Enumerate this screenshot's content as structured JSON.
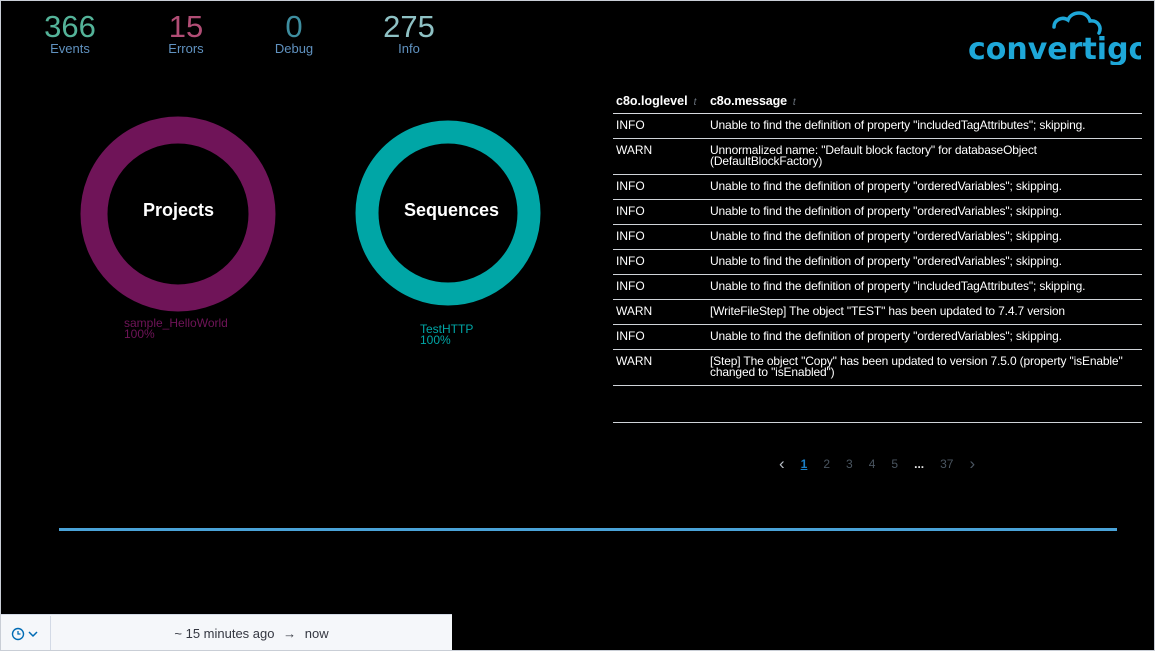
{
  "metrics": [
    {
      "value": "366",
      "label": "Events",
      "num_color": "#54b399",
      "label_color": "#6092c0"
    },
    {
      "value": "15",
      "label": "Errors",
      "num_color": "#b14d75",
      "label_color": "#6092c0"
    },
    {
      "value": "0",
      "label": "Debug",
      "num_color": "#3e8ea0",
      "label_color": "#6092c0"
    },
    {
      "value": "275",
      "label": "Info",
      "num_color": "#8ec1c4",
      "label_color": "#6092c0"
    }
  ],
  "brand": {
    "logo_text": "convertigo",
    "color": "#1ea7d8"
  },
  "donuts": {
    "projects": {
      "title": "Projects",
      "legend_name": "sample_HelloWorld",
      "legend_pct": "100%",
      "color": "#6f1458"
    },
    "sequences": {
      "title": "Sequences",
      "legend_name": "TestHTTP",
      "legend_pct": "100%",
      "color": "#00a6a6"
    }
  },
  "table": {
    "headers": {
      "level": "c8o.loglevel",
      "message": "c8o.message"
    },
    "sort_icon": "t",
    "rows": [
      {
        "level": "INFO",
        "message": "Unable to find the definition of property \"includedTagAttributes\"; skipping."
      },
      {
        "level": "WARN",
        "message": "Unnormalized name: \"Default block factory\" for databaseObject (DefaultBlockFactory)"
      },
      {
        "level": "INFO",
        "message": "Unable to find the definition of property \"orderedVariables\"; skipping."
      },
      {
        "level": "INFO",
        "message": "Unable to find the definition of property \"orderedVariables\"; skipping."
      },
      {
        "level": "INFO",
        "message": "Unable to find the definition of property \"orderedVariables\"; skipping."
      },
      {
        "level": "INFO",
        "message": "Unable to find the definition of property \"orderedVariables\"; skipping."
      },
      {
        "level": "INFO",
        "message": "Unable to find the definition of property \"includedTagAttributes\"; skipping."
      },
      {
        "level": "WARN",
        "message": "[WriteFileStep] The object \"TEST\" has been updated to 7.4.7 version"
      },
      {
        "level": "INFO",
        "message": "Unable to find the definition of property \"orderedVariables\"; skipping."
      },
      {
        "level": "WARN",
        "message": "[Step] The object \"Copy\" has been updated to version 7.5.0 (property \"isEnable\" changed to \"isEnabled\")"
      }
    ]
  },
  "pagination": {
    "prev": "‹",
    "pages": [
      "1",
      "2",
      "3",
      "4",
      "5"
    ],
    "ellipsis": "...",
    "last": "37",
    "next": "›",
    "active": "1"
  },
  "timepicker": {
    "from": "~ 15 minutes ago",
    "arrow": "→",
    "to": "now",
    "icon": "clock-icon"
  }
}
